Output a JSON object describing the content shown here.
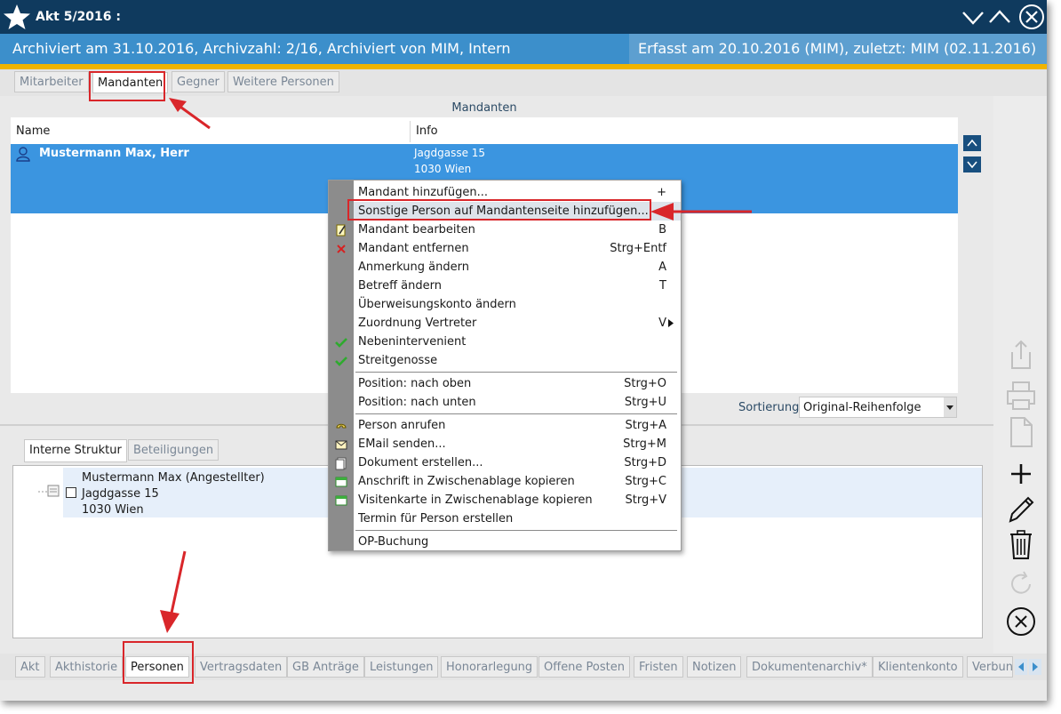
{
  "window": {
    "title": "Akt 5/2016 :",
    "archive_info": "Archiviert am 31.10.2016, Archivzahl: 2/16, Archiviert von  MIM, Intern",
    "record_info": "Erfasst am 20.10.2016 (MIM), zuletzt: MIM (02.11.2016)"
  },
  "top_tabs": [
    "Mitarbeiter",
    "Mandanten",
    "Gegner",
    "Weitere Personen"
  ],
  "mandanten": {
    "panel_title": "Mandanten",
    "col_name": "Name",
    "col_info": "Info",
    "rows": [
      {
        "name": "Mustermann Max, Herr",
        "info_line1": "Jagdgasse 15",
        "info_line2": "1030 Wien"
      }
    ],
    "sort_label": "Sortierung",
    "sort_value": "Original-Reihenfolge"
  },
  "context_menu": {
    "items": [
      {
        "label": "Mandant hinzufügen...",
        "shortcut": "+"
      },
      {
        "label": "Sonstige Person auf Mandantenseite hinzufügen...",
        "shortcut": ""
      },
      {
        "label": "Mandant bearbeiten",
        "shortcut": "B"
      },
      {
        "label": "Mandant entfernen",
        "shortcut": "Strg+Entf"
      },
      {
        "label": "Anmerkung ändern",
        "shortcut": "A"
      },
      {
        "label": "Betreff ändern",
        "shortcut": "T"
      },
      {
        "label": "Überweisungskonto ändern",
        "shortcut": ""
      },
      {
        "label": "Zuordnung Vertreter",
        "shortcut": "V"
      },
      {
        "label": "Nebenintervenient",
        "shortcut": ""
      },
      {
        "label": "Streitgenosse",
        "shortcut": ""
      },
      {
        "label": "Position: nach oben",
        "shortcut": "Strg+O"
      },
      {
        "label": "Position: nach unten",
        "shortcut": "Strg+U"
      },
      {
        "label": "Person anrufen",
        "shortcut": "Strg+A"
      },
      {
        "label": "EMail senden...",
        "shortcut": "Strg+M"
      },
      {
        "label": "Dokument erstellen...",
        "shortcut": "Strg+D"
      },
      {
        "label": "Anschrift in Zwischenablage kopieren",
        "shortcut": "Strg+C"
      },
      {
        "label": "Visitenkarte in Zwischenablage kopieren",
        "shortcut": "Strg+V"
      },
      {
        "label": "Termin für Person erstellen",
        "shortcut": ""
      },
      {
        "label": "OP-Buchung",
        "shortcut": ""
      }
    ]
  },
  "lower_tabs": [
    "Interne Struktur",
    "Beteiligungen"
  ],
  "interne_struktur": {
    "line1": "Mustermann Max (Angestellter)",
    "line2": "Jagdgasse 15",
    "line3": "1030 Wien"
  },
  "bottom_tabs": [
    "Akt",
    "Akthistorie",
    "Personen",
    "Vertragsdaten",
    "GB Anträge",
    "Leistungen",
    "Honorarlegung",
    "Offene Posten",
    "Fristen",
    "Notizen",
    "Dokumentenarchiv*",
    "Klientenkonto",
    "Verbun"
  ],
  "colors": {
    "titlebar": "#0f3a5e",
    "infobar": "#3c8fcb",
    "accent_line": "#f0b400",
    "selection": "#3b95e0",
    "annotation_red": "#d9262a"
  }
}
